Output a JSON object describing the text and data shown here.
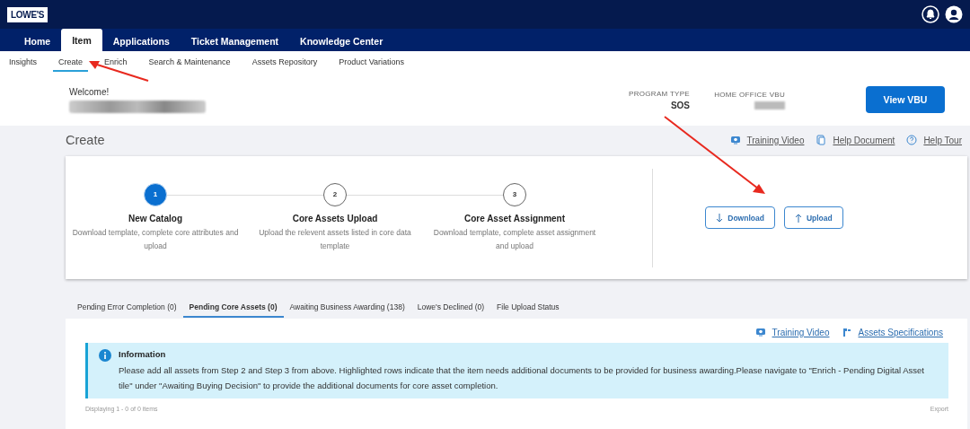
{
  "header": {
    "logo": "LOWE'S"
  },
  "nav": [
    {
      "label": "Home",
      "selected": false
    },
    {
      "label": "Item",
      "selected": true
    },
    {
      "label": "Applications",
      "selected": false
    },
    {
      "label": "Ticket Management",
      "selected": false
    },
    {
      "label": "Knowledge Center",
      "selected": false
    }
  ],
  "subnav": [
    {
      "label": "Insights",
      "selected": false
    },
    {
      "label": "Create",
      "selected": true
    },
    {
      "label": "Enrich",
      "selected": false
    },
    {
      "label": "Search & Maintenance",
      "selected": false
    },
    {
      "label": "Assets Repository",
      "selected": false
    },
    {
      "label": "Product Variations",
      "selected": false
    }
  ],
  "welcome": {
    "greeting": "Welcome!"
  },
  "info_fields": [
    {
      "label": "PROGRAM TYPE",
      "value": "SOS"
    },
    {
      "label": "HOME OFFICE VBU"
    }
  ],
  "view_button": "View VBU",
  "page_title": "Create",
  "help_links": [
    {
      "kind": "video",
      "label": "Training Video"
    },
    {
      "kind": "document",
      "label": "Help Document"
    },
    {
      "kind": "help",
      "label": "Help Tour"
    }
  ],
  "steps": [
    {
      "number": "1",
      "title": "New Catalog",
      "description": "Download template, complete core attributes and upload",
      "selected": true
    },
    {
      "number": "2",
      "title": "Core Assets Upload",
      "description": "Upload the relevent assets listed in core data template",
      "selected": false
    },
    {
      "number": "3",
      "title": "Core Asset Assignment",
      "description": "Download template, complete asset assignment and upload",
      "selected": false
    }
  ],
  "actions": [
    {
      "kind": "download",
      "label": "Download"
    },
    {
      "kind": "upload",
      "label": "Upload"
    }
  ],
  "tabs": [
    {
      "label": "Pending Error Completion (0)",
      "selected": false
    },
    {
      "label": "Pending Core Assets (0)",
      "selected": true
    },
    {
      "label": "Awaiting Business Awarding (138)",
      "selected": false
    },
    {
      "label": "Lowe's Declined (0)",
      "selected": false
    },
    {
      "label": "File Upload Status",
      "selected": false
    }
  ],
  "panel_links": [
    {
      "kind": "video",
      "label": "Training Video"
    },
    {
      "kind": "spec",
      "label": "Assets Specifications"
    }
  ],
  "information": {
    "title": "Information",
    "text": "Please add all assets from Step 2 and Step 3 from above. Highlighted rows indicate that the item needs additional documents to be provided for business awarding.Please navigate to \"Enrich - Pending Digital Asset tile\" under \"Awaiting Buying Decision\" to provide the additional documents for core asset completion."
  },
  "footer": {
    "count": "Displaying 1 - 0 of 0 items",
    "export": "Export"
  }
}
